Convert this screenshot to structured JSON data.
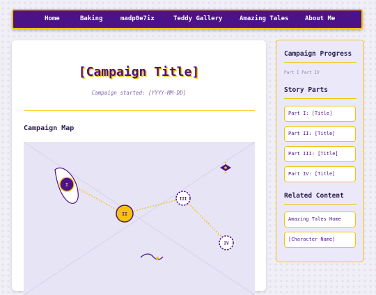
{
  "nav": {
    "items": [
      "Home",
      "Baking",
      "madp0e7ix",
      "Teddy Gallery",
      "Amazing Tales",
      "About Me"
    ]
  },
  "main": {
    "title": "[Campaign Title]",
    "started": "Campaign started: [YYYY-MM-DD]",
    "map_heading": "Campaign Map",
    "markers": [
      "I",
      "II",
      "III",
      "IV"
    ]
  },
  "sidebar": {
    "progress_heading": "Campaign Progress",
    "progress_text": "Part I Part IV",
    "story_heading": "Story Parts",
    "parts": [
      "Part I: [Title]",
      "Part II: [Title]",
      "Part III: [Title]",
      "Part IV: [Title]"
    ],
    "related_heading": "Related Content",
    "related": [
      "Amazing Tales Home",
      "[Character Name]"
    ]
  },
  "colors": {
    "purple": "#4c1287",
    "gold": "#f6c20c",
    "map_bg": "#e7e4f6"
  }
}
